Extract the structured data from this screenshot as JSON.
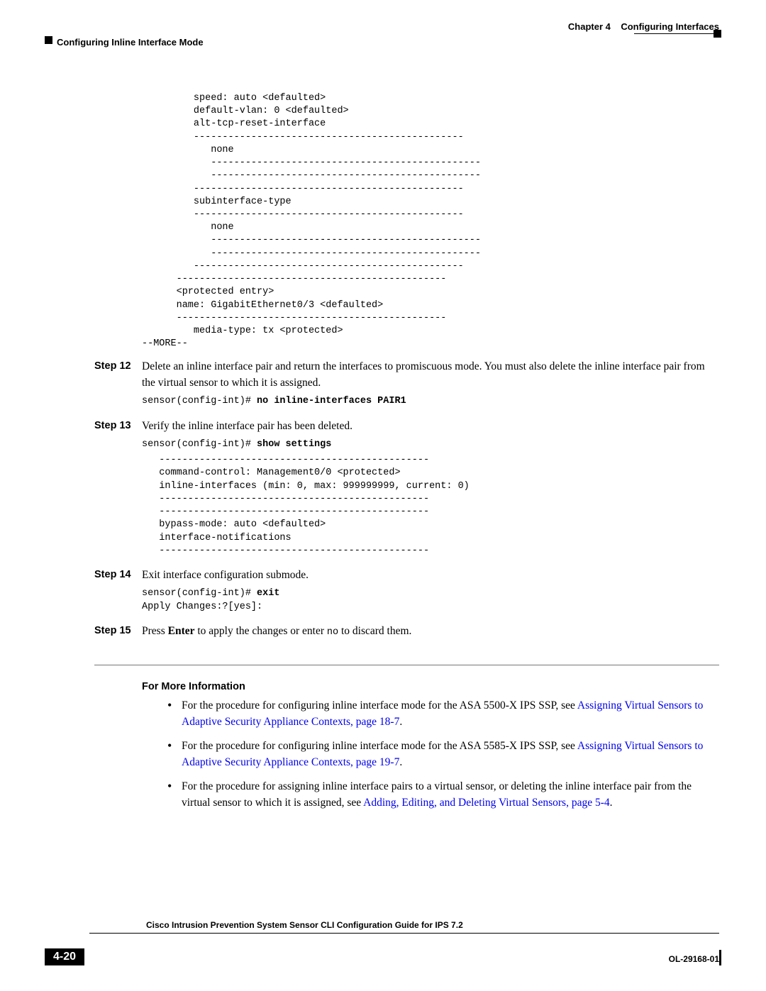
{
  "header": {
    "chapter_label": "Chapter 4",
    "chapter_title": "Configuring Interfaces",
    "section_title": "Configuring Inline Interface Mode"
  },
  "pre_top": "         speed: auto <defaulted>\n         default-vlan: 0 <defaulted>\n         alt-tcp-reset-interface\n         -----------------------------------------------\n            none\n            -----------------------------------------------\n            -----------------------------------------------\n         -----------------------------------------------\n         subinterface-type\n         -----------------------------------------------\n            none\n            -----------------------------------------------\n            -----------------------------------------------\n         -----------------------------------------------\n      -----------------------------------------------\n      <protected entry>\n      name: GigabitEthernet0/3 <defaulted>\n      -----------------------------------------------\n         media-type: tx <protected>\n--MORE--",
  "step12": {
    "label": "Step 12",
    "text": "Delete an inline interface pair and return the interfaces to promiscuous mode. You must also delete the inline interface pair from the virtual sensor to which it is assigned.",
    "cmd_prefix": "sensor(config-int)# ",
    "cmd_bold": "no inline-interfaces PAIR1"
  },
  "step13": {
    "label": "Step 13",
    "text": "Verify the inline interface pair has been deleted.",
    "cmd_prefix": "sensor(config-int)# ",
    "cmd_bold": "show settings",
    "output": "   -----------------------------------------------\n   command-control: Management0/0 <protected>\n   inline-interfaces (min: 0, max: 999999999, current: 0)\n   -----------------------------------------------\n   -----------------------------------------------\n   bypass-mode: auto <defaulted>\n   interface-notifications\n   -----------------------------------------------"
  },
  "step14": {
    "label": "Step 14",
    "text": "Exit interface configuration submode.",
    "cmd_prefix": "sensor(config-int)# ",
    "cmd_bold": "exit",
    "output": "Apply Changes:?[yes]:"
  },
  "step15": {
    "label": "Step 15",
    "t1": "Press ",
    "t2_bold": "Enter",
    "t3": " to apply the changes or enter ",
    "t4_mono": "no",
    "t5": " to discard them."
  },
  "fmi": {
    "heading": "For More Information",
    "b1": {
      "t1": "For the procedure for configuring inline interface mode for the ASA 5500-X IPS SSP, see ",
      "link": "Assigning Virtual Sensors to Adaptive Security Appliance Contexts, page 18-7",
      "t2": "."
    },
    "b2": {
      "t1": "For the procedure for configuring inline interface mode for the ASA 5585-X IPS SSP, see ",
      "link": "Assigning Virtual Sensors to Adaptive Security Appliance Contexts, page 19-7",
      "t2": "."
    },
    "b3": {
      "t1": "For the procedure for assigning inline interface pairs to a virtual sensor, or deleting the inline interface pair from the virtual sensor to which it is assigned, see ",
      "link": "Adding, Editing, and Deleting Virtual Sensors, page 5-4",
      "t2": "."
    }
  },
  "footer": {
    "doc_title": "Cisco Intrusion Prevention System Sensor CLI Configuration Guide for IPS 7.2",
    "page_number": "4-20",
    "doc_id": "OL-29168-01"
  }
}
